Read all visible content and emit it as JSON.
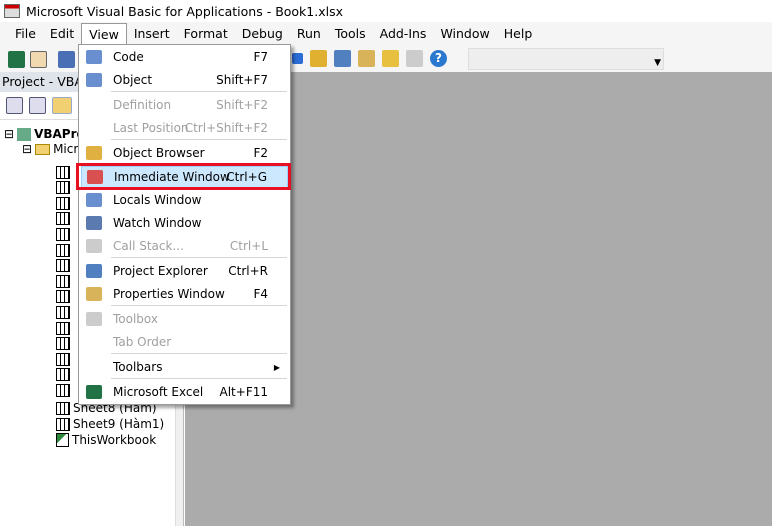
{
  "window": {
    "title": "Microsoft Visual Basic for Applications - Book1.xlsx"
  },
  "menubar": [
    "File",
    "Edit",
    "View",
    "Insert",
    "Format",
    "Debug",
    "Run",
    "Tools",
    "Add-Ins",
    "Window",
    "Help"
  ],
  "project_panel": {
    "title": "Project - VBAProject",
    "tree": {
      "root": "VBAProject",
      "folder": "Microsoft Excel Objects",
      "visible_items": [
        "Sheet8 (Hàm)",
        "Sheet9 (Hàm1)",
        "ThisWorkbook"
      ]
    }
  },
  "view_menu": [
    {
      "label": "Code",
      "shortcut": "F7",
      "enabled": true,
      "icon": "code-icon"
    },
    {
      "label": "Object",
      "shortcut": "Shift+F7",
      "enabled": true,
      "icon": "object-icon"
    },
    {
      "label": "Definition",
      "shortcut": "Shift+F2",
      "enabled": false
    },
    {
      "label": "Last Position",
      "shortcut": "Ctrl+Shift+F2",
      "enabled": false
    },
    {
      "label": "Object Browser",
      "shortcut": "F2",
      "enabled": true,
      "icon": "object-browser-icon"
    },
    {
      "label": "Immediate Window",
      "shortcut": "Ctrl+G",
      "enabled": true,
      "highlighted": true,
      "icon": "immediate-window-icon"
    },
    {
      "label": "Locals Window",
      "shortcut": "",
      "enabled": true,
      "icon": "locals-window-icon"
    },
    {
      "label": "Watch Window",
      "shortcut": "",
      "enabled": true,
      "icon": "watch-window-icon"
    },
    {
      "label": "Call Stack...",
      "shortcut": "Ctrl+L",
      "enabled": false,
      "icon": "call-stack-icon"
    },
    {
      "label": "Project Explorer",
      "shortcut": "Ctrl+R",
      "enabled": true,
      "icon": "project-explorer-icon"
    },
    {
      "label": "Properties Window",
      "shortcut": "F4",
      "enabled": true,
      "icon": "properties-icon"
    },
    {
      "label": "Toolbox",
      "shortcut": "",
      "enabled": false,
      "icon": "toolbox-icon"
    },
    {
      "label": "Tab Order",
      "shortcut": "",
      "enabled": false
    },
    {
      "label": "Toolbars",
      "shortcut": "",
      "enabled": true,
      "submenu": true
    },
    {
      "label": "Microsoft Excel",
      "shortcut": "Alt+F11",
      "enabled": true,
      "icon": "excel-icon"
    }
  ],
  "colors": {
    "highlight": "#cce8ff",
    "annotation": "#e81123",
    "workspace": "#ababab"
  }
}
